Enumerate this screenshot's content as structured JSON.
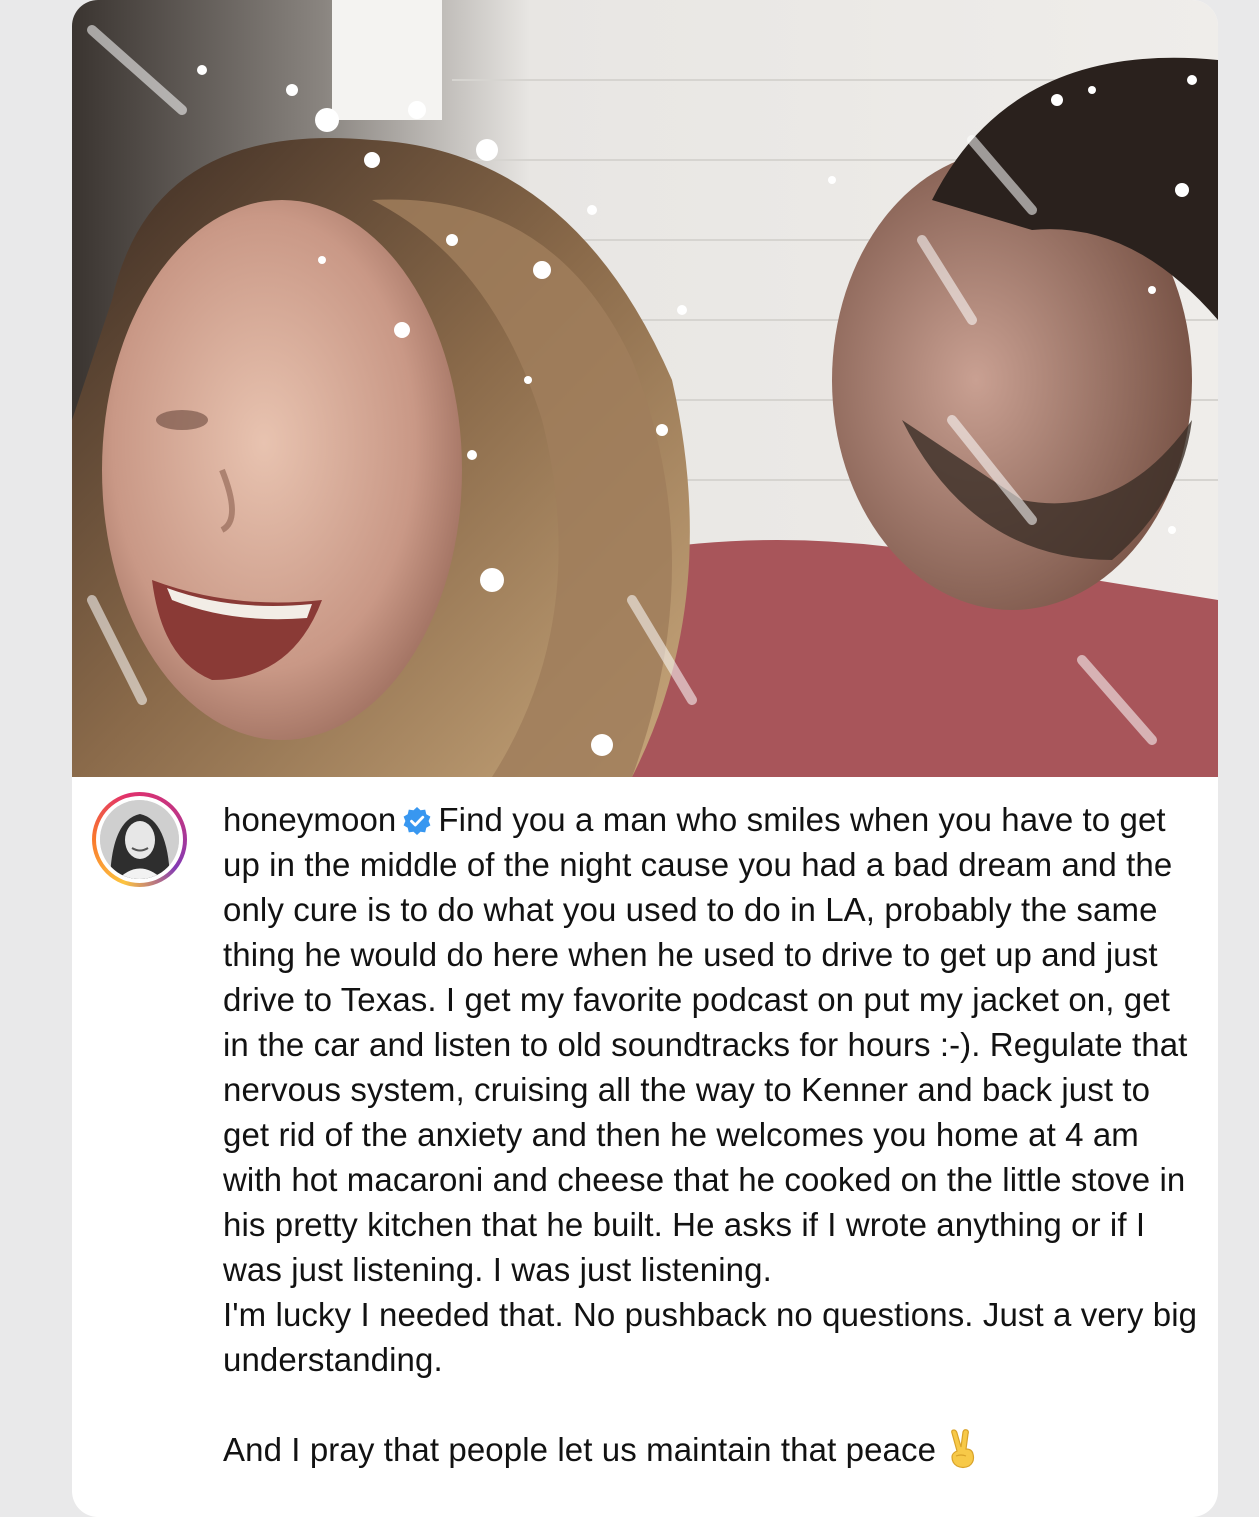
{
  "post": {
    "username": "honeymoon",
    "verified_icon": "verified-badge-icon",
    "caption_main": "Find you a man who smiles when you have to get up in the middle of the night cause you had a bad dream and the only cure is to do what you used to do in LA, probably the same thing he would do here when he used to drive to get up and just drive to Texas. I get my favorite podcast on put my jacket on, get in the car and listen to old soundtracks for hours :-). Regulate that nervous system, cruising all the way to Kenner and back just to get rid of the anxiety and then he welcomes you home at 4 am with hot macaroni and cheese that he cooked on the little stove in his pretty kitchen that he built. He asks if I wrote anything or if I was just listening. I was just listening.",
    "caption_second": "I'm lucky I needed that. No pushback no questions. Just a very big understanding.",
    "caption_last": "And I pray that people let us maintain that peace",
    "emoji_icon": "victory-hand-icon",
    "colors": {
      "verified_blue": "#3897f0",
      "text": "#121212"
    }
  }
}
